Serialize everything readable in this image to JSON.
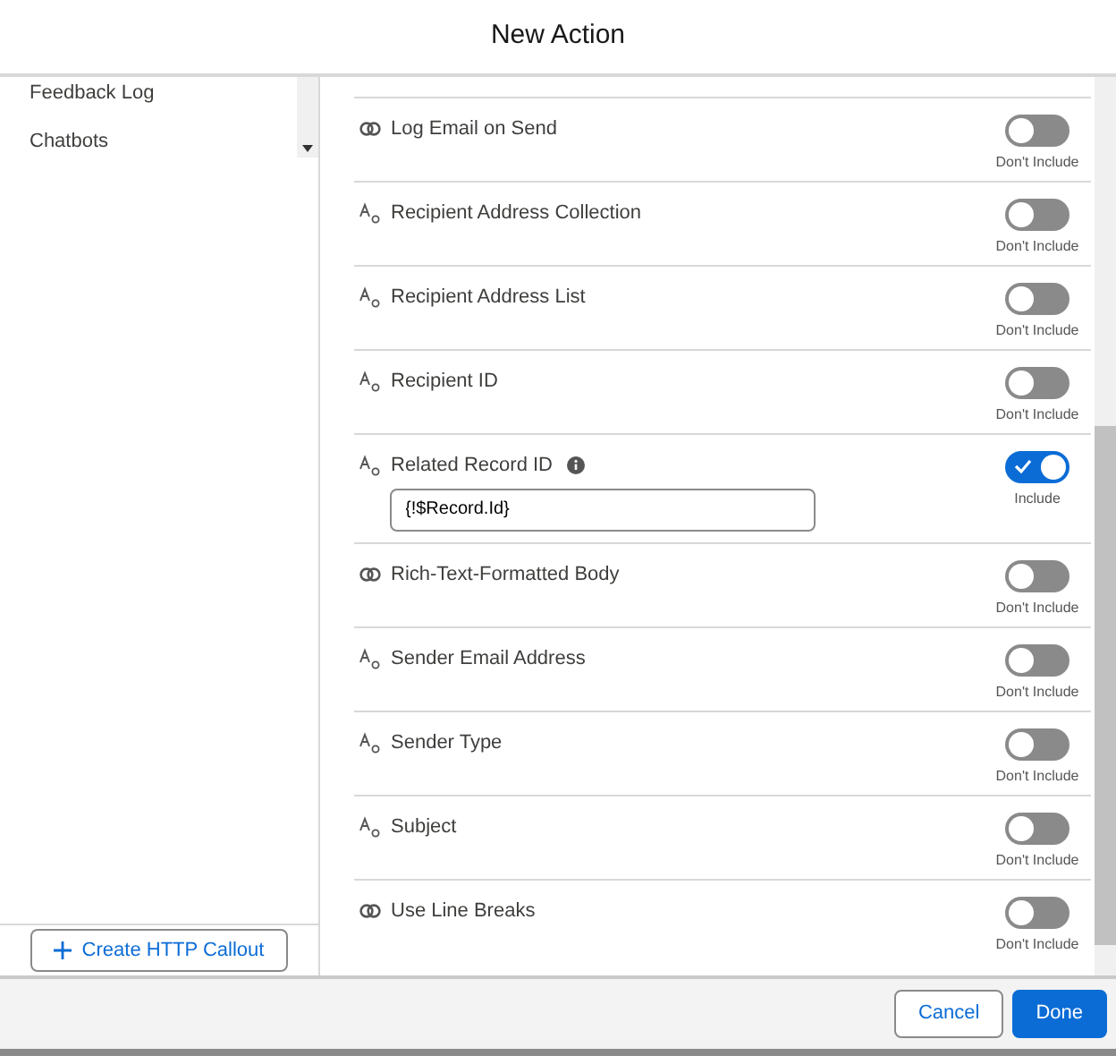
{
  "window": {
    "title": "New Action"
  },
  "sidebar": {
    "items": [
      {
        "label": "Feedback Log"
      },
      {
        "label": "Chatbots"
      }
    ],
    "button": "Create HTTP Callout"
  },
  "fields": [
    {
      "kind": "boolean",
      "label": "Log Email on Send",
      "on": false,
      "toggle_label": "Don't Include"
    },
    {
      "kind": "text",
      "label": "Recipient Address Collection",
      "on": false,
      "toggle_label": "Don't Include"
    },
    {
      "kind": "text",
      "label": "Recipient Address List",
      "on": false,
      "toggle_label": "Don't Include"
    },
    {
      "kind": "text",
      "label": "Recipient ID",
      "on": false,
      "toggle_label": "Don't Include"
    },
    {
      "kind": "text",
      "label": "Related Record ID",
      "info": true,
      "value": "{!$Record.Id}",
      "on": true,
      "toggle_label": "Include"
    },
    {
      "kind": "boolean",
      "label": "Rich-Text-Formatted Body",
      "on": false,
      "toggle_label": "Don't Include"
    },
    {
      "kind": "text",
      "label": "Sender Email Address",
      "on": false,
      "toggle_label": "Don't Include"
    },
    {
      "kind": "text",
      "label": "Sender Type",
      "on": false,
      "toggle_label": "Don't Include"
    },
    {
      "kind": "text",
      "label": "Subject",
      "on": false,
      "toggle_label": "Don't Include"
    },
    {
      "kind": "boolean",
      "label": "Use Line Breaks",
      "on": false,
      "toggle_label": "Don't Include"
    }
  ],
  "footer": {
    "buttons": [
      "Cancel",
      "Done"
    ]
  }
}
